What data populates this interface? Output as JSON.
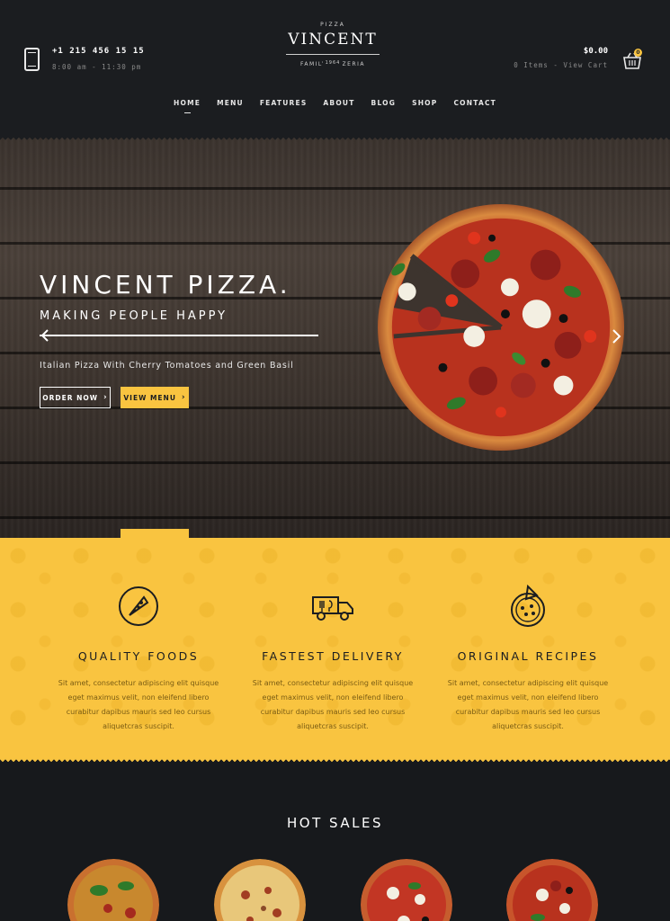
{
  "header": {
    "phone": "+1 215 456 15 15",
    "hours": "8:00 am - 11:30 pm",
    "logo": {
      "top": "PIZZA",
      "name": "VINCENT",
      "year": "1964",
      "sub": "FAMILY PIZZERIA"
    },
    "cart": {
      "total": "$0.00",
      "items_text": "0 Items - View Cart",
      "badge": "0"
    }
  },
  "nav": {
    "items": [
      "HOME",
      "MENU",
      "FEATURES",
      "ABOUT",
      "BLOG",
      "SHOP",
      "CONTACT"
    ],
    "active": "HOME"
  },
  "hero": {
    "title": "VINCENT PIZZA.",
    "subtitle": "MAKING PEOPLE HAPPY",
    "description": "Italian Pizza With Cherry Tomatoes and Green Basil",
    "order_button": "ORDER NOW",
    "menu_button": "VIEW MENU"
  },
  "features": [
    {
      "icon": "pizza-slice-plate-icon",
      "title": "QUALITY FOODS",
      "text": "Sit amet, consectetur adipiscing elit quisque eget maximus velit, non eleifend libero curabitur dapibus mauris sed leo cursus aliquetcras suscipit."
    },
    {
      "icon": "delivery-truck-icon",
      "title": "FASTEST DELIVERY",
      "text": "Sit amet, consectetur adipiscing elit quisque eget maximus velit, non eleifend libero curabitur dapibus mauris sed leo cursus aliquetcras suscipit."
    },
    {
      "icon": "pizza-recipe-icon",
      "title": "ORIGINAL RECIPES",
      "text": "Sit amet, consectetur adipiscing elit quisque eget maximus velit, non eleifend libero curabitur dapibus mauris sed leo cursus aliquetcras suscipit."
    }
  ],
  "hot_sales": {
    "title": "HOT SALES"
  },
  "colors": {
    "accent": "#f9c440",
    "dark": "#1b1d20"
  }
}
